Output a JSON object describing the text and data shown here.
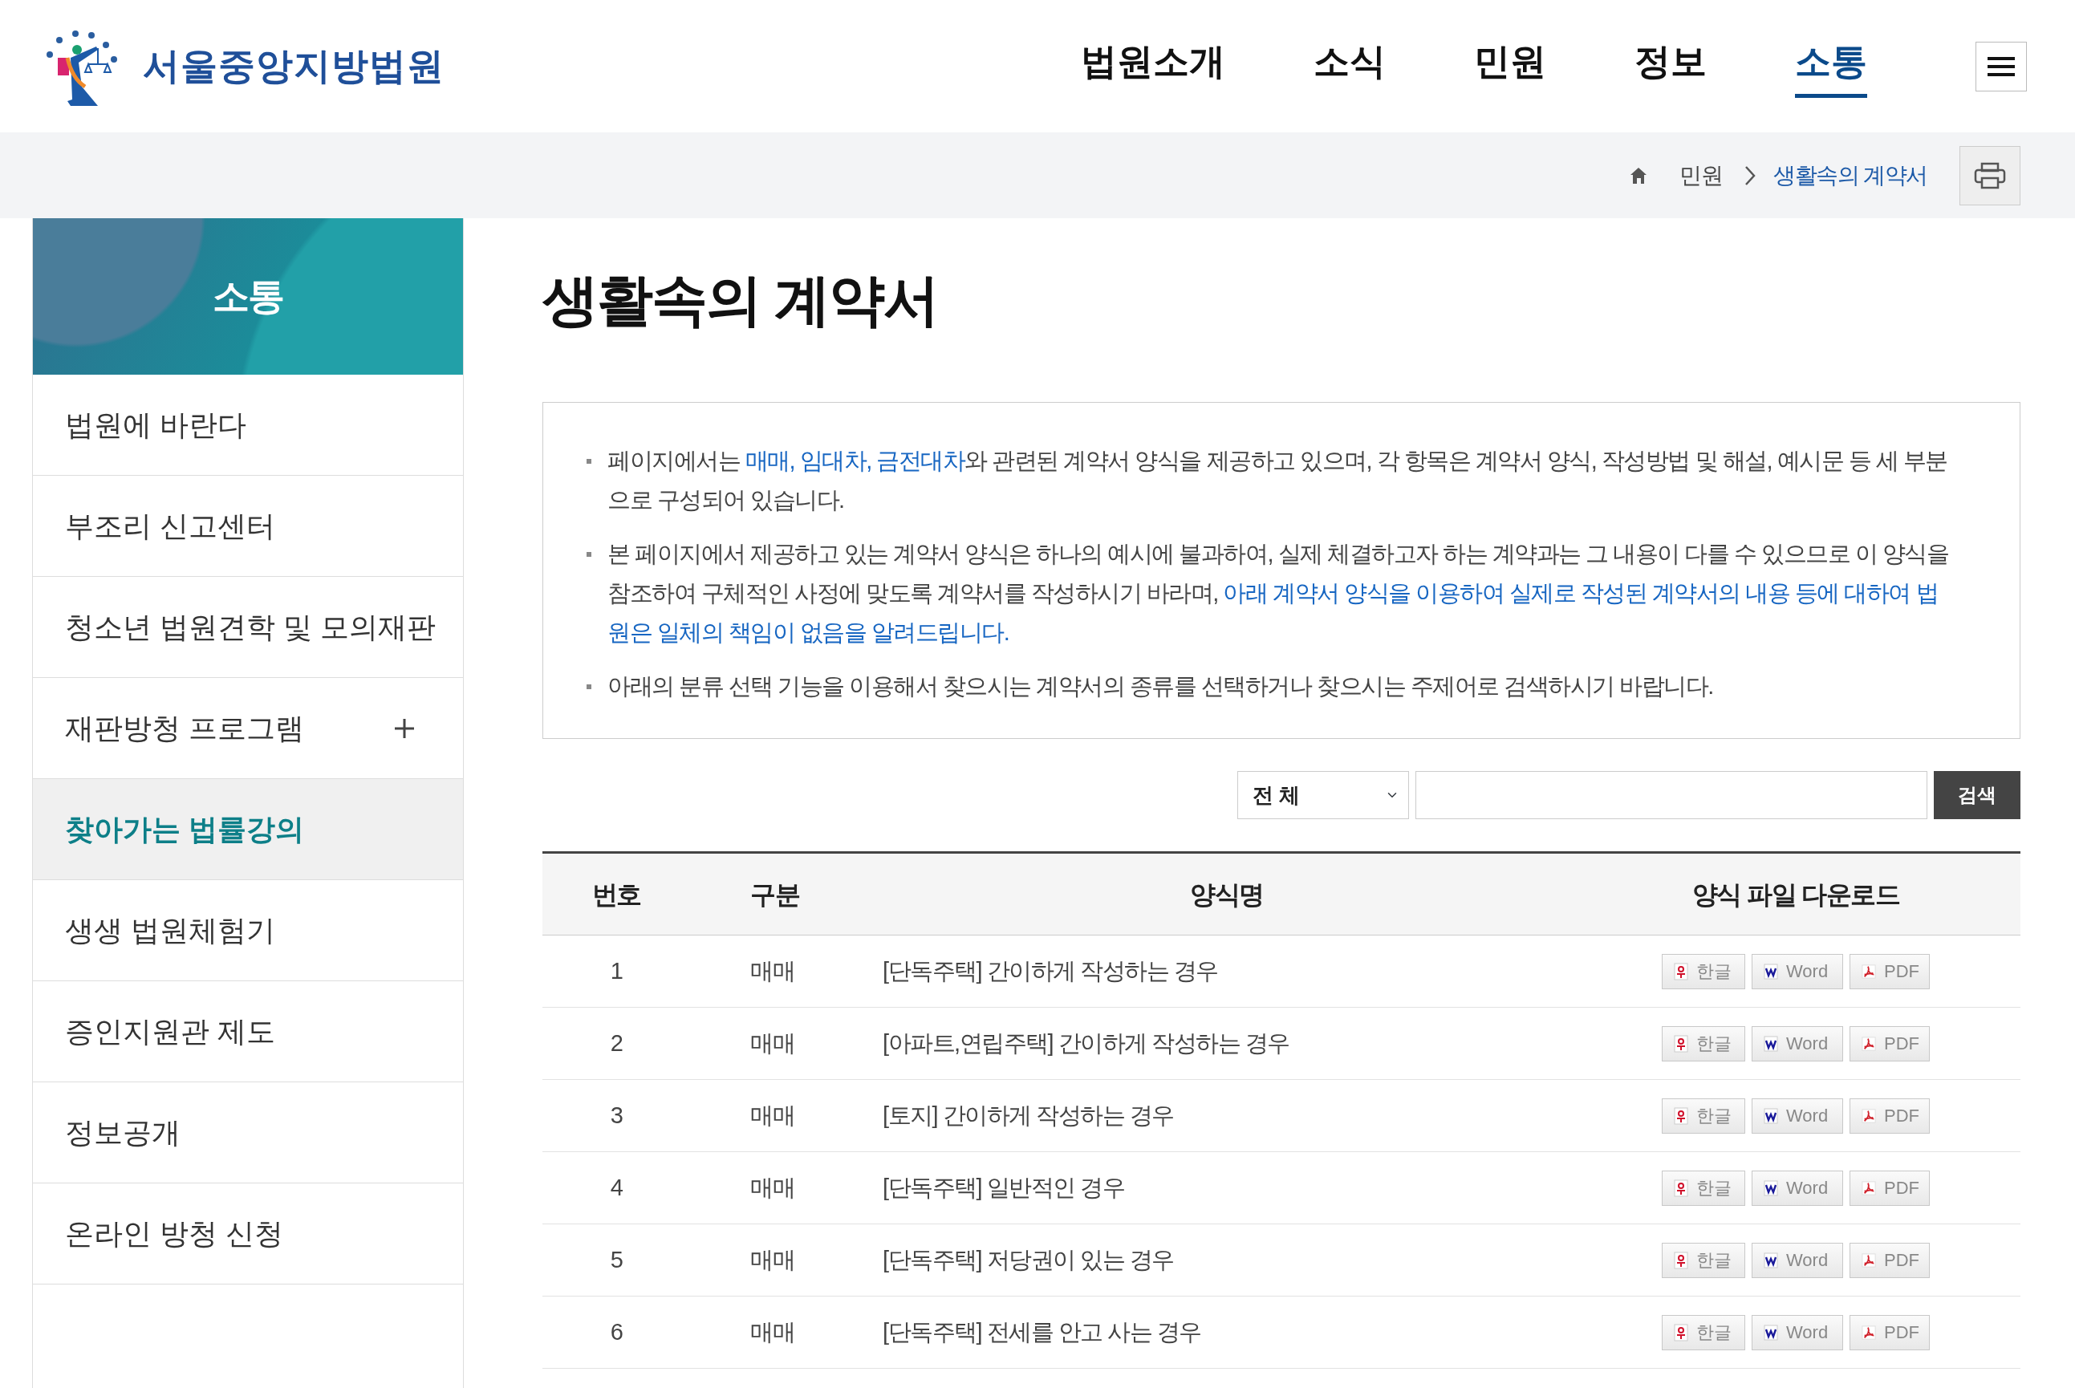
{
  "logo": {
    "text": "서울중앙지방법원"
  },
  "nav": [
    {
      "label": "법원소개",
      "selected": false
    },
    {
      "label": "소식",
      "selected": false
    },
    {
      "label": "민원",
      "selected": false
    },
    {
      "label": "정보",
      "selected": false
    },
    {
      "label": "소통",
      "selected": true
    }
  ],
  "breadcrumb": [
    {
      "label": "민원",
      "current": false
    },
    {
      "label": "생활속의 계약서",
      "current": true
    }
  ],
  "sidebar": {
    "title": "소통",
    "items": [
      {
        "label": "법원에 바란다",
        "selected": false,
        "expandable": false
      },
      {
        "label": "부조리 신고센터",
        "selected": false,
        "expandable": false
      },
      {
        "label": "청소년 법원견학 및 모의재판",
        "selected": false,
        "expandable": false
      },
      {
        "label": "재판방청 프로그램",
        "selected": false,
        "expandable": true
      },
      {
        "label": "찾아가는 법률강의",
        "selected": true,
        "expandable": false
      },
      {
        "label": "생생 법원체험기",
        "selected": false,
        "expandable": false
      },
      {
        "label": "증인지원관 제도",
        "selected": false,
        "expandable": false
      },
      {
        "label": "정보공개",
        "selected": false,
        "expandable": false
      },
      {
        "label": "온라인 방청 신청",
        "selected": false,
        "expandable": false
      }
    ]
  },
  "page_title": "생활속의 계약서",
  "notices": [
    [
      {
        "text": "페이지에서는 ",
        "highlight": false
      },
      {
        "text": "매매, 임대차, 금전대차",
        "highlight": true
      },
      {
        "text": "와 관련된 계약서 양식을 제공하고 있으며, 각 항목은 계약서 양식, 작성방법 및 해설, 예시문 등 세 부분으로 구성되어 있습니다.",
        "highlight": false
      }
    ],
    [
      {
        "text": "본 페이지에서 제공하고 있는 계약서 양식은 하나의 예시에 불과하여, 실제 체결하고자 하는 계약과는 그 내용이 다를 수 있으므로 이 양식을 참조하여 구체적인 사정에 맞도록 계약서를 작성하시기 바라며, ",
        "highlight": false
      },
      {
        "text": "아래 계약서 양식을 이용하여 실제로 작성된 계약서의 내용 등에 대하여 법원은 일체의 책임이 없음을 알려드립니다.",
        "highlight": true
      }
    ],
    [
      {
        "text": "아래의 분류 선택 기능을 이용해서 찾으시는 계약서의 종류를 선택하거나 찾으시는 주제어로 검색하시기 바랍니다.",
        "highlight": false
      }
    ]
  ],
  "search": {
    "select": "전 체",
    "button": "검색"
  },
  "table": {
    "columns": [
      "번호",
      "구분",
      "양식명",
      "양식 파일 다운로드"
    ],
    "rows": [
      {
        "number": "1",
        "category": "매매",
        "title": "[단독주택] 간이하게 작성하는 경우",
        "downloads": [
          {
            "kind": "hwp",
            "label": "한글"
          },
          {
            "kind": "word",
            "label": "Word"
          },
          {
            "kind": "pdf",
            "label": "PDF"
          }
        ]
      },
      {
        "number": "2",
        "category": "매매",
        "title": "[아파트,연립주택] 간이하게 작성하는 경우",
        "downloads": [
          {
            "kind": "hwp",
            "label": "한글"
          },
          {
            "kind": "word",
            "label": "Word"
          },
          {
            "kind": "pdf",
            "label": "PDF"
          }
        ]
      },
      {
        "number": "3",
        "category": "매매",
        "title": "[토지] 간이하게 작성하는 경우",
        "downloads": [
          {
            "kind": "hwp",
            "label": "한글"
          },
          {
            "kind": "word",
            "label": "Word"
          },
          {
            "kind": "pdf",
            "label": "PDF"
          }
        ]
      },
      {
        "number": "4",
        "category": "매매",
        "title": "[단독주택] 일반적인 경우",
        "downloads": [
          {
            "kind": "hwp",
            "label": "한글"
          },
          {
            "kind": "word",
            "label": "Word"
          },
          {
            "kind": "pdf",
            "label": "PDF"
          }
        ]
      },
      {
        "number": "5",
        "category": "매매",
        "title": "[단독주택] 저당권이 있는 경우",
        "downloads": [
          {
            "kind": "hwp",
            "label": "한글"
          },
          {
            "kind": "word",
            "label": "Word"
          },
          {
            "kind": "pdf",
            "label": "PDF"
          }
        ]
      },
      {
        "number": "6",
        "category": "매매",
        "title": "[단독주택] 전세를 안고 사는 경우",
        "downloads": [
          {
            "kind": "hwp",
            "label": "한글"
          },
          {
            "kind": "word",
            "label": "Word"
          },
          {
            "kind": "pdf",
            "label": "PDF"
          }
        ]
      }
    ]
  }
}
